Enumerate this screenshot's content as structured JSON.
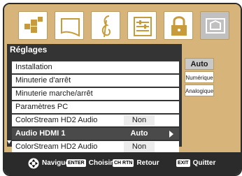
{
  "menu": {
    "title": "Réglages",
    "items": [
      {
        "label": "Installation",
        "value": ""
      },
      {
        "label": "Minuterie d'arrêt",
        "value": ""
      },
      {
        "label": "Minuterie marche/arrêt",
        "value": ""
      },
      {
        "label": "Paramètres PC",
        "value": ""
      },
      {
        "label": "ColorStream HD2 Audio",
        "value": "Non"
      },
      {
        "label": "Audio HDMI 1",
        "value": "Auto"
      },
      {
        "label": "ColorStream HD2 Audio",
        "value": "Non"
      }
    ],
    "selected_index": 5
  },
  "submenu": {
    "options": [
      "Auto",
      "Numérique",
      "Analogique"
    ],
    "selected": "Auto"
  },
  "icons": [
    "picture-icon",
    "screen-icon",
    "audio-icon",
    "setup-icon",
    "lock-icon",
    "preferences-icon"
  ],
  "help": {
    "navigate": "Naviguer",
    "enter_key": "ENTER",
    "enter_label": "Choisir",
    "return_key": "CH RTN",
    "return_label": "Retour",
    "exit_key": "EXIT",
    "exit_label": "Quitter"
  },
  "colors": {
    "panel": "#d7b57a",
    "menu_bg": "#343434",
    "selected_row": "#4a4a4a",
    "helpbar": "#2b2b2b"
  }
}
